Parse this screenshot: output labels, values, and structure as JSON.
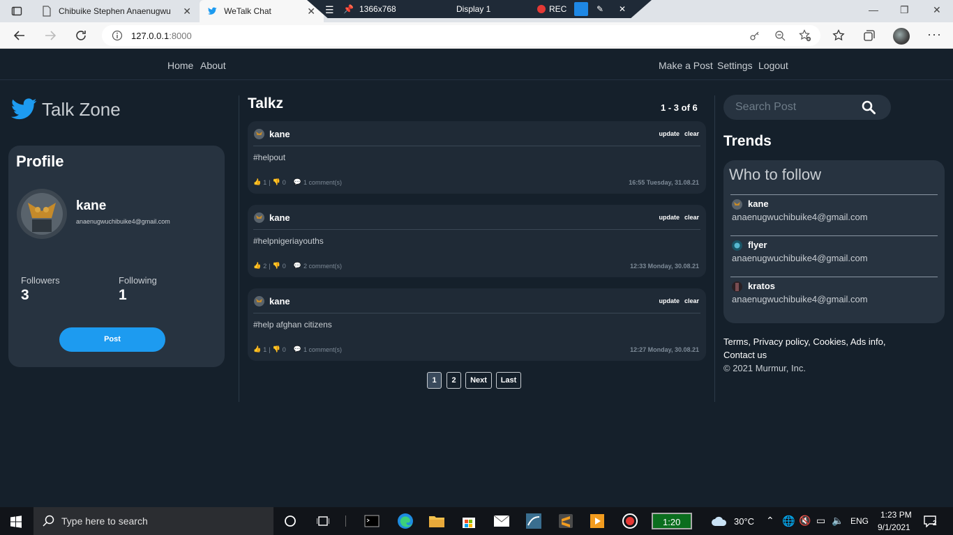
{
  "browser": {
    "tabs": [
      {
        "title": "Chibuike Stephen Anaenugwu"
      },
      {
        "title": "WeTalk Chat"
      }
    ],
    "recorder": {
      "resolution": "1366x768",
      "display": "Display 1",
      "rec": "REC"
    },
    "url_host": "127.0.0.1",
    "url_port": ":8000"
  },
  "nav": {
    "left": [
      "Home",
      "About"
    ],
    "right": [
      "Make a Post",
      "Settings",
      "Logout"
    ]
  },
  "brand": {
    "name": "Talk Zone"
  },
  "profile": {
    "heading": "Profile",
    "name": "kane",
    "email": "anaenugwuchibuike4@gmail.com",
    "followers_label": "Followers",
    "followers": "3",
    "following_label": "Following",
    "following": "1",
    "post_button": "Post"
  },
  "feed": {
    "title": "Talkz",
    "count": "1 - 3 of 6",
    "posts": [
      {
        "author": "kane",
        "update": "update",
        "clear": "clear",
        "body": "#helpout",
        "likes": "1",
        "dislikes": "0",
        "comments": "1 comment(s)",
        "time": "16:55 Tuesday, 31.08.21"
      },
      {
        "author": "kane",
        "update": "update",
        "clear": "clear",
        "body": "#helpnigeriayouths",
        "likes": "2",
        "dislikes": "0",
        "comments": "2 comment(s)",
        "time": "12:33 Monday, 30.08.21"
      },
      {
        "author": "kane",
        "update": "update",
        "clear": "clear",
        "body": "#help afghan citizens",
        "likes": "1",
        "dislikes": "0",
        "comments": "1 comment(s)",
        "time": "12:27 Monday, 30.08.21"
      }
    ],
    "pagination": [
      "1",
      "2",
      "Next",
      "Last"
    ],
    "current_page": "1"
  },
  "sidebar": {
    "search_placeholder": "Search Post",
    "trends_title": "Trends",
    "who_to_follow_title": "Who to follow",
    "suggestions": [
      {
        "name": "kane",
        "email": "anaenugwuchibuike4@gmail.com"
      },
      {
        "name": "flyer",
        "email": "anaenugwuchibuike4@gmail.com"
      },
      {
        "name": "kratos",
        "email": "anaenugwuchibuike4@gmail.com"
      }
    ],
    "footer_links": [
      "Terms",
      "Privacy policy",
      "Cookies",
      "Ads info",
      "Contact us"
    ],
    "copyright": "© 2021 Murmur, Inc."
  },
  "taskbar": {
    "search_placeholder": "Type here to search",
    "battery_time": "1:20",
    "temperature": "30°C",
    "language": "ENG",
    "time": "1:23 PM",
    "date": "9/1/2021",
    "notifications": "2"
  },
  "colors": {
    "accent": "#1d9bf0",
    "background": "#15202b",
    "card": "#273340"
  }
}
